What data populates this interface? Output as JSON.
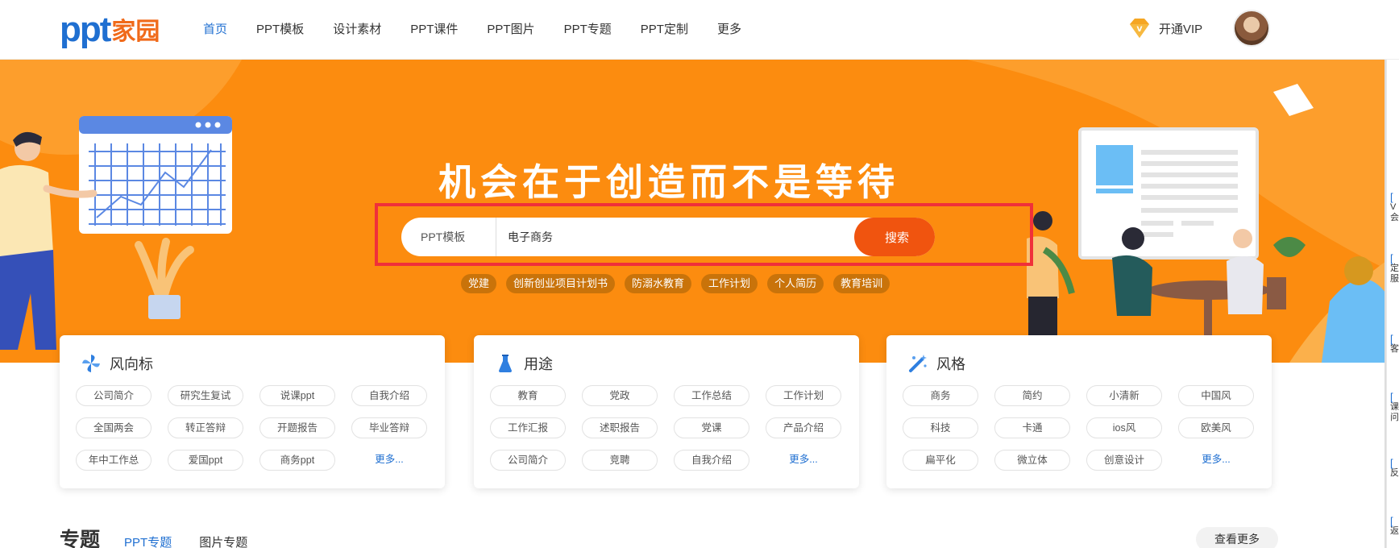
{
  "header": {
    "logo_text_a": "ppt",
    "logo_text_b": "家园",
    "nav": [
      "首页",
      "PPT模板",
      "设计素材",
      "PPT课件",
      "PPT图片",
      "PPT专题",
      "PPT定制",
      "更多"
    ],
    "nav_more_icon": "",
    "vip_label": "开通VIP"
  },
  "banner": {
    "headline": "机会在于创造而不是等待",
    "search": {
      "category": "PPT模板",
      "category_caret": "",
      "value": "电子商务",
      "button_icon": "",
      "button_label": "搜索"
    },
    "tags": [
      "党建",
      "创新创业项目计划书",
      "防溺水教育",
      "工作计划",
      "个人简历",
      "教育培训"
    ],
    "slider_icon": ""
  },
  "cards": [
    {
      "title": "风向标",
      "items": [
        "公司简介",
        "研究生复试",
        "说课ppt",
        "自我介绍",
        "全国两会",
        "转正答辩",
        "开题报告",
        "毕业答辩",
        "年中工作总",
        "爱国ppt",
        "商务ppt",
        "更多..."
      ]
    },
    {
      "title": "用途",
      "items": [
        "教育",
        "党政",
        "工作总结",
        "工作计划",
        "工作汇报",
        "述职报告",
        "党课",
        "产品介绍",
        "公司简介",
        "竞聘",
        "自我介绍",
        "更多..."
      ]
    },
    {
      "title": "风格",
      "items": [
        "商务",
        "简约",
        "小清新",
        "中国风",
        "科技",
        "卡通",
        "ios风",
        "欧美风",
        "扁平化",
        "微立体",
        "创意设计",
        "更多..."
      ]
    }
  ],
  "topic": {
    "heading": "专题",
    "tab_active": "PPT专题",
    "tab_other": "图片专题",
    "see_more": "查看更多"
  },
  "right_sidebar": [
    {
      "icon": "[",
      "text": "V\n会"
    },
    {
      "icon": "[",
      "text": "定\n服"
    },
    {
      "icon": "[",
      "text": "客"
    },
    {
      "icon": "[",
      "text": "课\n问"
    },
    {
      "icon": "[",
      "text": "反"
    },
    {
      "icon": "[",
      "text": "返"
    }
  ],
  "colors": {
    "brand_blue": "#1f6fd1",
    "banner_orange": "#fc8c0f",
    "search_button": "#f0540f",
    "highlight_box": "#f0303a"
  }
}
